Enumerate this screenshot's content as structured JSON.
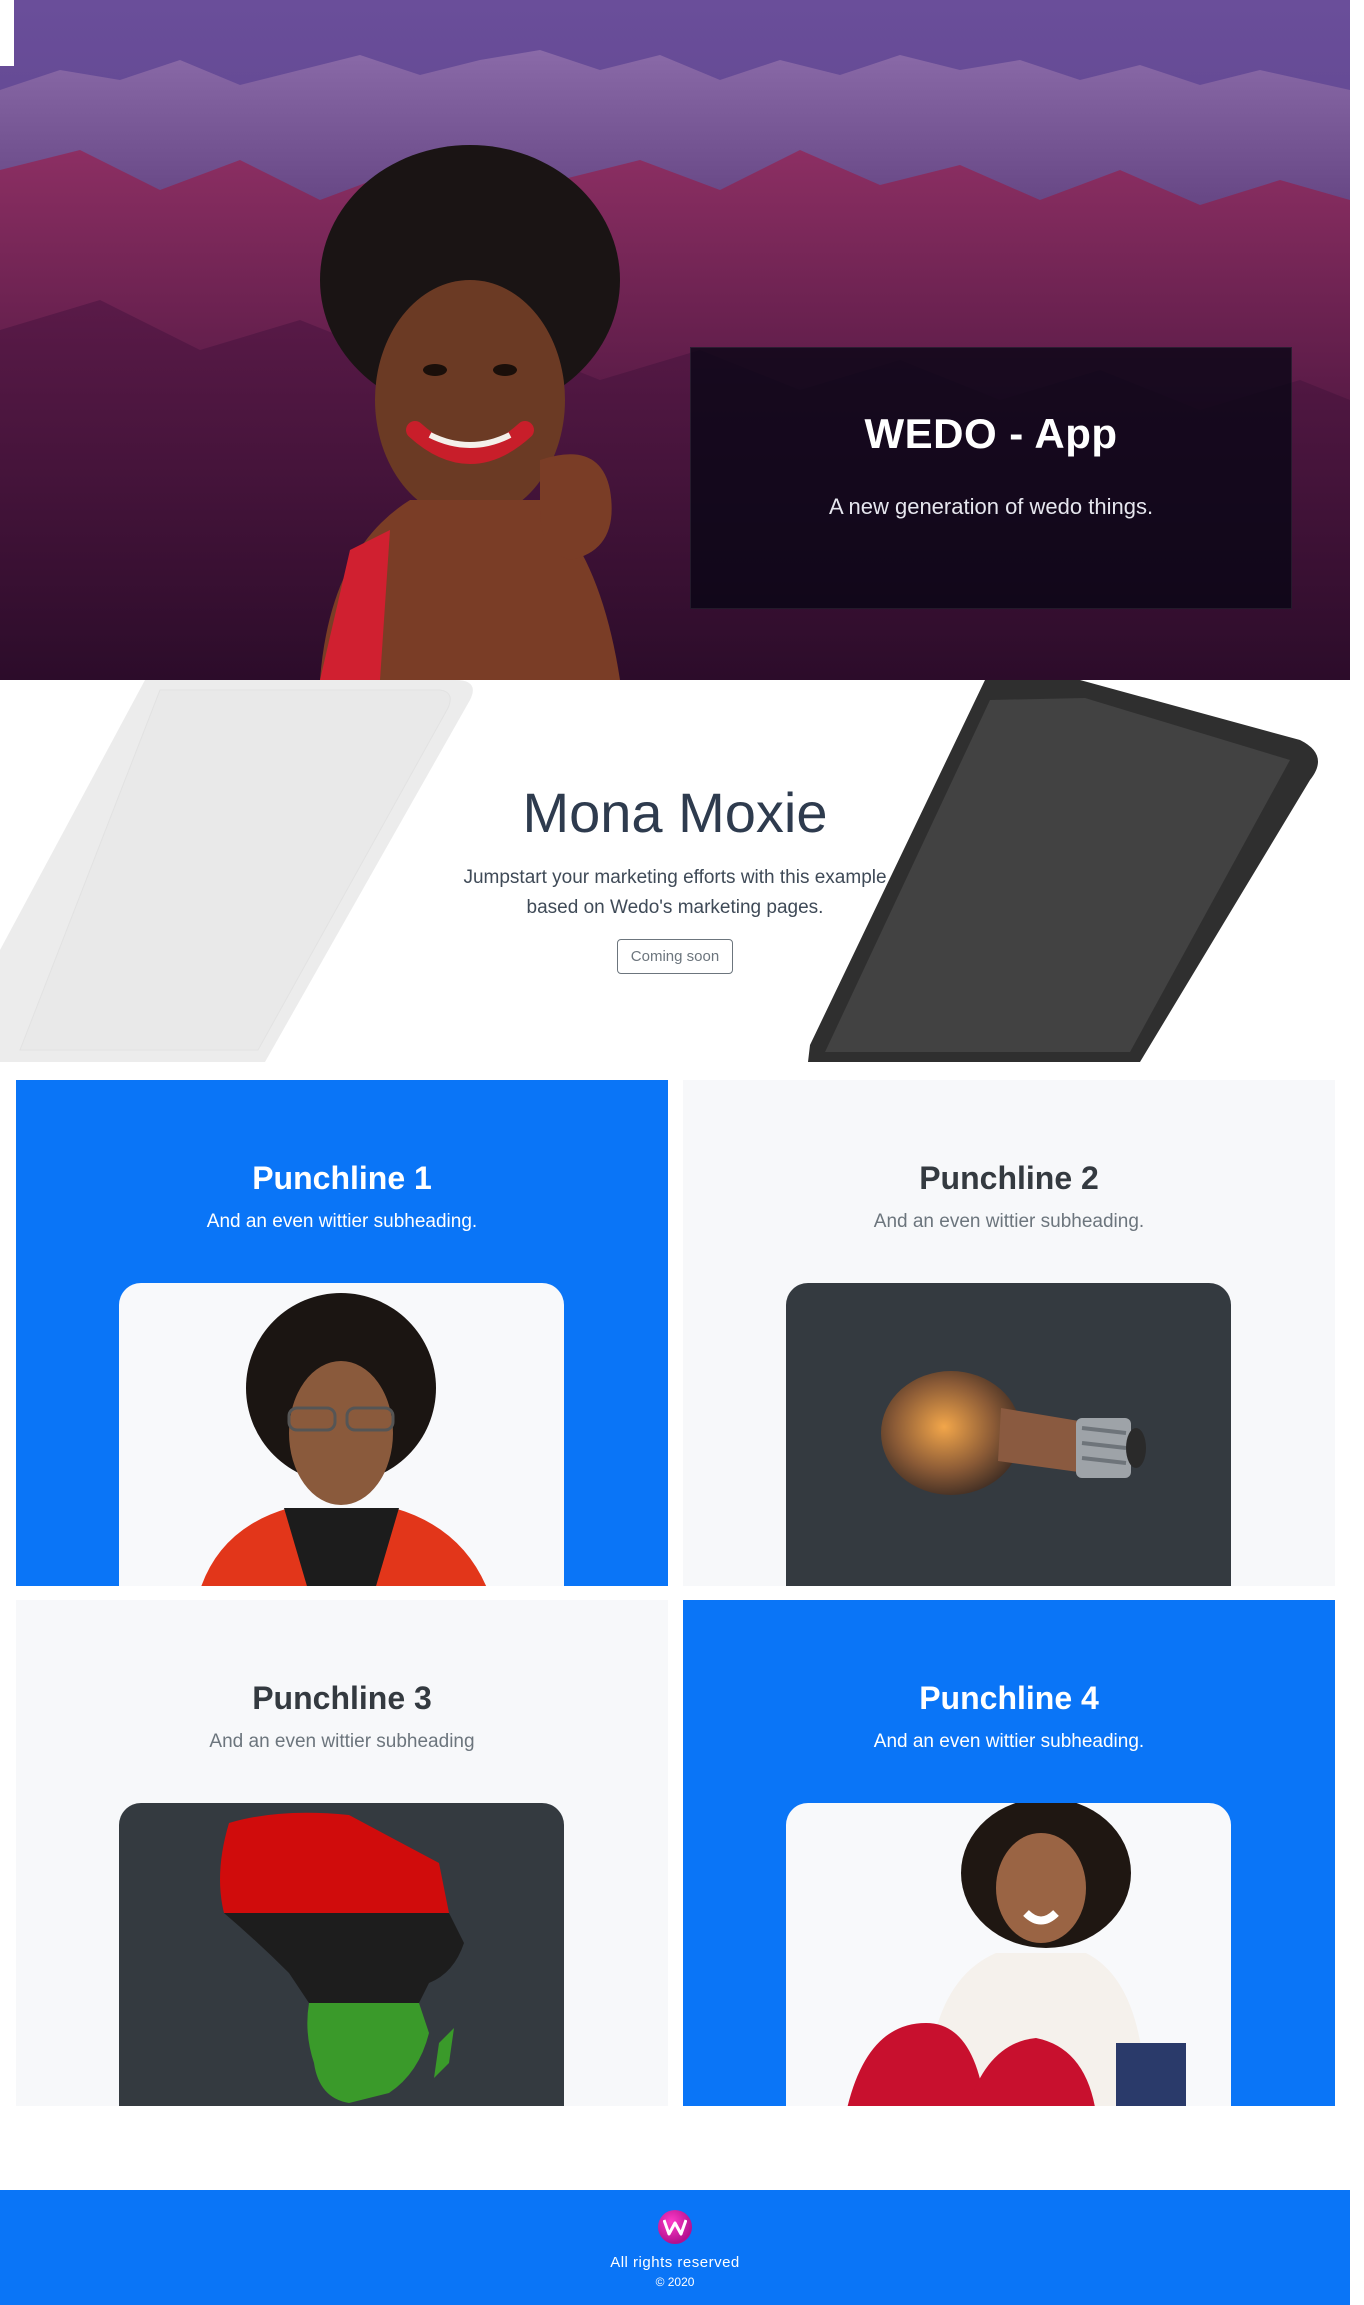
{
  "hero": {
    "title": "WEDO - App",
    "subtitle": "A new generation of wedo things."
  },
  "promo": {
    "title": "Mona Moxie",
    "lead": "Jumpstart your marketing efforts with this example based on Wedo's marketing pages.",
    "button_label": "Coming soon"
  },
  "panels": [
    {
      "title": "Punchline 1",
      "subtitle": "And an even wittier subheading.",
      "style": "blue",
      "image": "young-man-portrait"
    },
    {
      "title": "Punchline 2",
      "subtitle": "And an even wittier subheading.",
      "style": "light",
      "image": "light-bulb"
    },
    {
      "title": "Punchline 3",
      "subtitle": "And an even wittier subheading",
      "style": "light",
      "image": "africa-map-flag"
    },
    {
      "title": "Punchline 4",
      "subtitle": "And an even wittier subheading.",
      "style": "blue",
      "image": "laughing-woman"
    }
  ],
  "footer": {
    "logo_icon": "wedo-logo-icon",
    "text": "All rights reserved",
    "copyright": "© 2020"
  },
  "colors": {
    "primary_blue": "#0a75f7",
    "light_panel": "#f7f8fa",
    "dark_card": "#343a40",
    "logo_magenta": "#d01aa8"
  }
}
